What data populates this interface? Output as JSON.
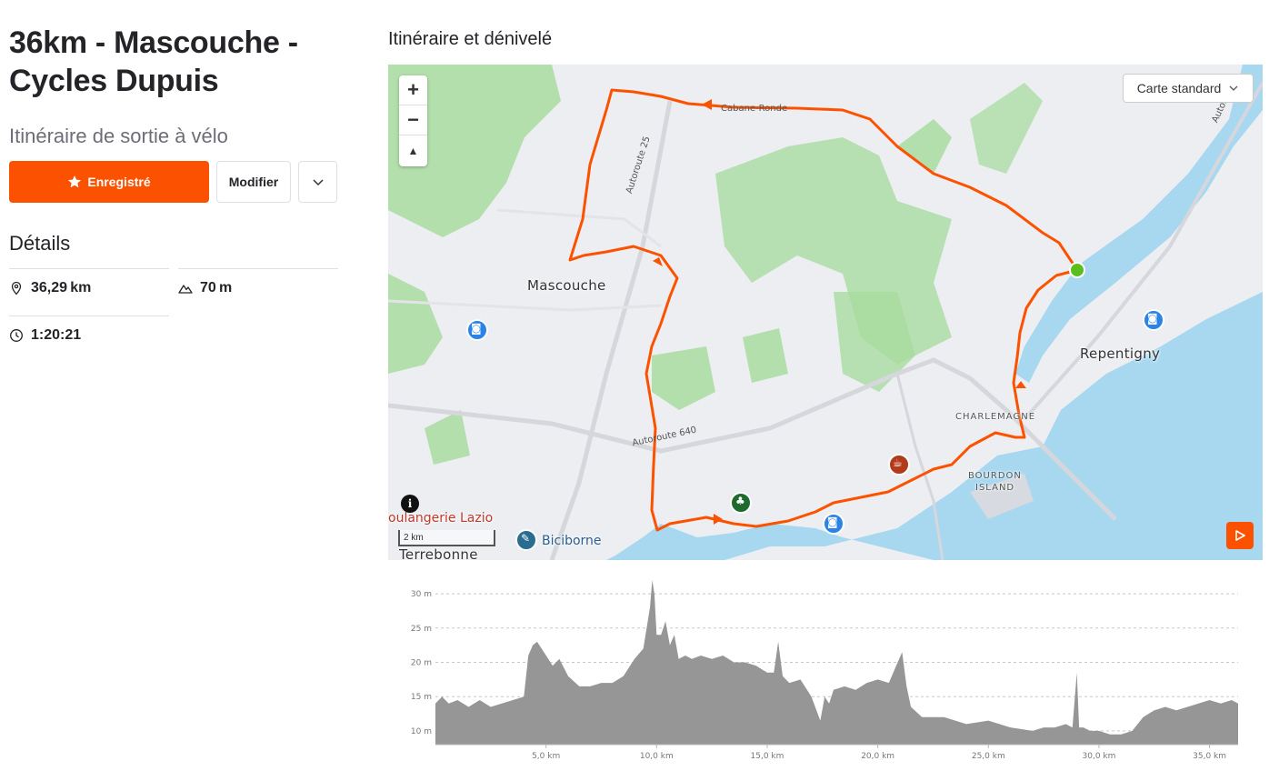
{
  "route": {
    "title": "36km - Mascouche - Cycles Dupuis",
    "subtitle": "Itinéraire de sortie à vélo",
    "saved_label": "Enregistré",
    "edit_label": "Modifier",
    "details_heading": "Détails",
    "distance": "36,29 km",
    "elevation_gain": "70 m",
    "moving_time": "1:20:21"
  },
  "map": {
    "section_title": "Itinéraire et dénivelé",
    "style_selector": "Carte standard",
    "scale_label": "2 km",
    "labels": {
      "mascouche": "Mascouche",
      "repentigny": "Repentigny",
      "charlemagne": "CHARLEMAGNE",
      "bourdon1": "BOURDON",
      "bourdon2": "ISLAND",
      "terrebonne": "Terrebonne",
      "cabane": "Cabane-Ronde",
      "a25": "Autoroute 25",
      "a640": "Autoroute 640",
      "a40": "Autorou",
      "boulangerie": "oulangerie Lazio",
      "biciborne": "Biciborne"
    },
    "colors": {
      "route": "#fc5200",
      "start": "#5cbe1e",
      "water": "#a7d8f0",
      "park": "#a9dca0"
    },
    "icons": [
      "zoom-in-icon",
      "zoom-out-icon",
      "compass-icon",
      "chevron-down-icon",
      "play-icon",
      "info-icon",
      "camera-icon",
      "tree-icon",
      "coffee-icon",
      "wrench-icon"
    ]
  },
  "chart_data": {
    "type": "area",
    "title": "",
    "xlabel": "",
    "ylabel": "",
    "xlim": [
      0,
      36.29
    ],
    "ylim": [
      8,
      32
    ],
    "xticks": [
      "5,0 km",
      "10,0 km",
      "15,0 km",
      "20,0 km",
      "25,0 km",
      "30,0 km",
      "35,0 km"
    ],
    "xtick_values": [
      5,
      10,
      15,
      20,
      25,
      30,
      35
    ],
    "yticks": [
      "10 m",
      "15 m",
      "20 m",
      "25 m",
      "30 m"
    ],
    "ytick_values": [
      10,
      15,
      20,
      25,
      30
    ],
    "grid": true,
    "fill_color": "#969696",
    "series": [
      {
        "x": [
          0,
          0.3,
          0.6,
          1.0,
          1.5,
          2.0,
          2.5,
          3.0,
          3.5,
          4.0,
          4.2,
          4.4,
          4.6,
          4.8,
          5.0,
          5.3,
          5.6,
          6.0,
          6.5,
          7.0,
          7.5,
          8.0,
          8.5,
          9.0,
          9.4,
          9.7,
          9.8,
          9.9,
          10.0,
          10.2,
          10.4,
          10.6,
          10.8,
          11.0,
          11.3,
          11.6,
          12.0,
          12.5,
          13.0,
          13.5,
          14.0,
          14.5,
          15.0,
          15.3,
          15.5,
          15.7,
          16.0,
          16.5,
          17.0,
          17.4,
          17.6,
          17.8,
          18.0,
          18.5,
          19.0,
          19.5,
          20.0,
          20.5,
          20.9,
          21.1,
          21.3,
          21.5,
          22.0,
          23.0,
          24.0,
          25.0,
          26.0,
          27.0,
          27.5,
          28.0,
          28.5,
          28.8,
          29.0,
          29.1,
          29.3,
          29.6,
          30.0,
          30.5,
          31.0,
          31.5,
          32.0,
          32.5,
          33.0,
          33.5,
          34.0,
          34.5,
          35.0,
          35.5,
          36.0,
          36.29
        ],
        "y": [
          14,
          15,
          14,
          14.5,
          13.5,
          14.5,
          13.5,
          14,
          14.5,
          15,
          21,
          22.5,
          23,
          22,
          21,
          19.5,
          20.5,
          18,
          16.5,
          16.5,
          17,
          17,
          18,
          20.5,
          22,
          28,
          32,
          30,
          24,
          24,
          26,
          22.5,
          24,
          20.5,
          21,
          20.5,
          21,
          20.5,
          21,
          20,
          20,
          19.5,
          18.5,
          18.5,
          23,
          18,
          17,
          17.5,
          15,
          11.5,
          15,
          14,
          16,
          16.5,
          16,
          17,
          17.5,
          17,
          20,
          21.5,
          16.5,
          13.5,
          12,
          12,
          11,
          11.5,
          10.5,
          10,
          10.5,
          10.5,
          11,
          10.5,
          18.5,
          10.5,
          10.5,
          10,
          10,
          9.5,
          9.5,
          10,
          12,
          13,
          13.5,
          13,
          13.5,
          14,
          14.5,
          14,
          14.5,
          14
        ]
      }
    ]
  }
}
